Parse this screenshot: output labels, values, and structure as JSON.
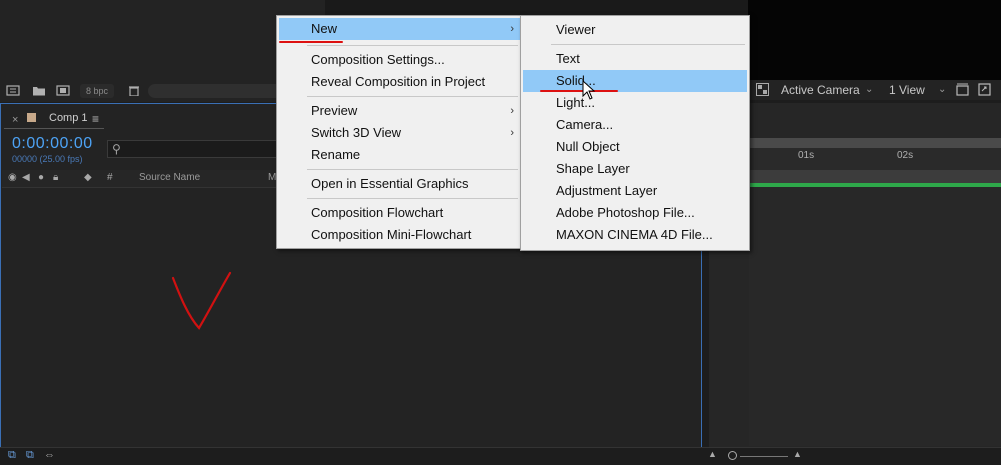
{
  "project_panel": {
    "bpc_label": "8 bpc"
  },
  "viewer_toolbar": {
    "camera_select": "Active Camera",
    "view_select": "1 View"
  },
  "timeline": {
    "tab_label": "Comp 1",
    "tab_close": "×",
    "tab_menu": "≡",
    "timecode": "0:00:00:00",
    "frames": "00000 (25.00 fps)",
    "column_source": "Source Name",
    "column_mode": "M",
    "column_hash": "#",
    "ruler_labels": [
      "01s",
      "02s"
    ]
  },
  "context_menu": {
    "items": [
      {
        "label": "New",
        "has_submenu": true,
        "highlighted": true
      },
      {
        "label": "Composition Settings...",
        "has_submenu": false
      },
      {
        "label": "Reveal Composition in Project",
        "has_submenu": false
      },
      {
        "label": "Preview",
        "has_submenu": true
      },
      {
        "label": "Switch 3D View",
        "has_submenu": true
      },
      {
        "label": "Rename",
        "has_submenu": false
      },
      {
        "label": "Open in Essential Graphics",
        "has_submenu": false
      },
      {
        "label": "Composition Flowchart",
        "has_submenu": false
      },
      {
        "label": "Composition Mini-Flowchart",
        "has_submenu": false
      }
    ]
  },
  "submenu_new": {
    "items": [
      {
        "label": "Viewer"
      },
      {
        "label": "Text"
      },
      {
        "label": "Solid...",
        "highlighted": true
      },
      {
        "label": "Light..."
      },
      {
        "label": "Camera..."
      },
      {
        "label": "Null Object"
      },
      {
        "label": "Shape Layer"
      },
      {
        "label": "Adjustment Layer"
      },
      {
        "label": "Adobe Photoshop File..."
      },
      {
        "label": "MAXON CINEMA 4D File..."
      }
    ]
  },
  "colors": {
    "timecode": "#4da3f5",
    "menu_highlight": "#91c9f7",
    "annotation_red": "#d11111",
    "timeline_green": "#2ea84a"
  },
  "icons": [
    "interpret-footage-icon",
    "folder-icon",
    "new-composition-icon",
    "trash-icon",
    "search-icon",
    "eye-icon",
    "audio-icon",
    "solo-icon",
    "lock-icon",
    "label-icon",
    "mouse-cursor-icon"
  ]
}
